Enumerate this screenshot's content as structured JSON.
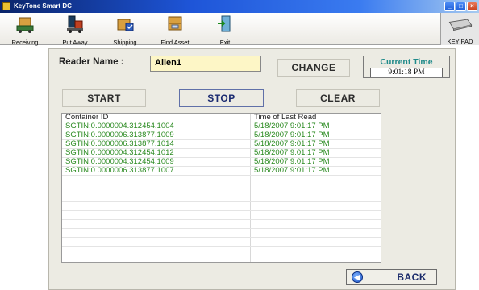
{
  "window": {
    "title": "KeyTone Smart DC"
  },
  "toolbar": {
    "items": [
      {
        "label": "Receiving",
        "icon": "receiving-icon"
      },
      {
        "label": "Put Away",
        "icon": "put-away-icon"
      },
      {
        "label": "Shipping",
        "icon": "shipping-icon"
      },
      {
        "label": "Find Asset",
        "icon": "find-asset-icon"
      },
      {
        "label": "Exit",
        "icon": "exit-icon"
      }
    ],
    "keypad_label": "KEY PAD"
  },
  "reader": {
    "label": "Reader Name :",
    "value": "Alien1",
    "change_label": "CHANGE"
  },
  "time": {
    "title": "Current Time",
    "value": "9:01:18 PM"
  },
  "controls": {
    "start_label": "START",
    "stop_label": "STOP",
    "clear_label": "CLEAR"
  },
  "grid": {
    "columns": [
      "Container ID",
      "Time of Last Read"
    ],
    "rows": [
      [
        "SGTIN:0.0000004.312454.1004",
        "5/18/2007 9:01:17 PM"
      ],
      [
        "SGTIN:0.0000006.313877.1009",
        "5/18/2007 9:01:17 PM"
      ],
      [
        "SGTIN:0.0000006.313877.1014",
        "5/18/2007 9:01:17 PM"
      ],
      [
        "SGTIN:0.0000004.312454.1012",
        "5/18/2007 9:01:17 PM"
      ],
      [
        "SGTIN:0.0000004.312454.1009",
        "5/18/2007 9:01:17 PM"
      ],
      [
        "SGTIN:0.0000006.313877.1007",
        "5/18/2007 9:01:17 PM"
      ]
    ]
  },
  "back_label": "BACK",
  "colors": {
    "data_text": "#2a8a20",
    "time_title": "#1f8a8a",
    "reader_input_bg": "#fdf6c6"
  }
}
